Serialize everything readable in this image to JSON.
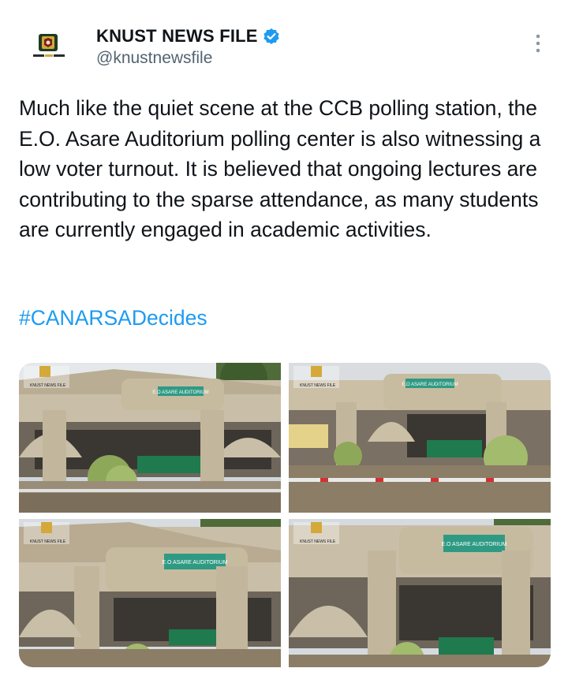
{
  "tweet": {
    "display_name": "KNUST NEWS FILE",
    "handle": "@knustnewsfile",
    "verified": true,
    "body": "Much like the quiet scene at the CCB polling station, the E.O. Asare Auditorium polling center is also witnessing a low voter turnout. It is believed that ongoing lectures are contributing to the sparse attendance, as many students are currently engaged in academic activities.",
    "hashtag": "#CANARSADecides"
  },
  "icons": {
    "more": "more-vertical-icon",
    "verified": "verified-badge-icon"
  },
  "media": {
    "sign_text": "E.O. ASARE AUDITORIUM",
    "watermark": "KNUST NEWS FILE"
  },
  "colors": {
    "link": "#1d9bf0",
    "secondary_text": "#536471",
    "verified": "#1d9bf0"
  }
}
